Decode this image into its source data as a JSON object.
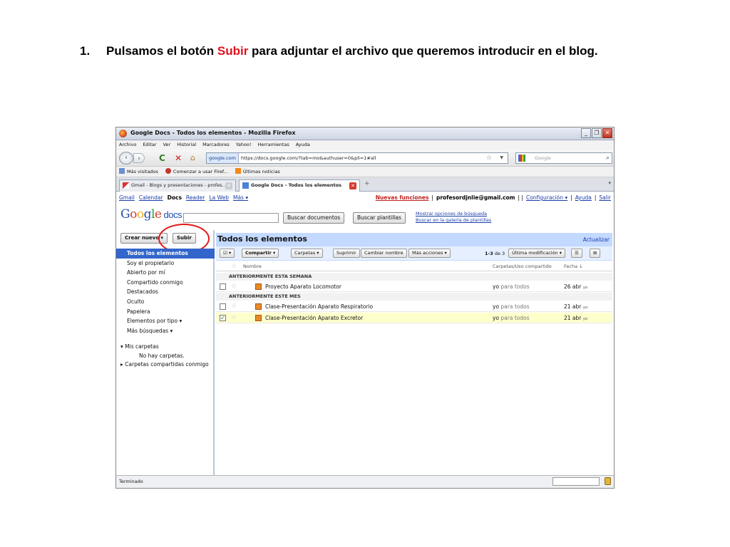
{
  "instruction": {
    "number": "1.",
    "before": "Pulsamos el botón ",
    "highlight": "Subir",
    "after": " para adjuntar el archivo que queremos introducir en el blog."
  },
  "window": {
    "title": "Google Docs - Todos los elementos - Mozilla Firefox",
    "minimize": "_",
    "restore": "❐",
    "close": "✕"
  },
  "menu": [
    "Archivo",
    "Editar",
    "Ver",
    "Historial",
    "Marcadores",
    "Yahoo!",
    "Herramientas",
    "Ayuda"
  ],
  "nav": {
    "back": "‹",
    "forward": "›",
    "reload": "C",
    "stop": "✕",
    "home": "⌂",
    "site": "google.com",
    "url": "https://docs.google.com/?tab=mo&authuser=0&pli=1#all",
    "star": "☆",
    "search_placeholder": "Google"
  },
  "bookmarks": [
    "Más visitados",
    "Comenzar a usar Firef...",
    "Últimas noticias"
  ],
  "tabs": [
    {
      "label": "Gmail - Blogs y presentaciones - profes...",
      "active": false
    },
    {
      "label": "Google Docs - Todos los elementos",
      "active": true
    }
  ],
  "gbar": {
    "links": [
      "Gmail",
      "Calendar",
      "Docs",
      "Reader",
      "La Web",
      "Más ▾"
    ],
    "new_features": "Nuevas funciones",
    "sep1": "|",
    "email": "profesordjnlie@gmail.com",
    "sep2": "| |",
    "settings": "Configuración ▾",
    "sep3": "|",
    "help": "Ayuda",
    "sep4": "|",
    "signout": "Salir"
  },
  "logo": {
    "g1": "G",
    "o1": "o",
    "o2": "o",
    "g2": "g",
    "l": "l",
    "e": "e",
    "docs": "docs"
  },
  "search": {
    "button_docs": "Buscar documentos",
    "button_templates": "Buscar plantillas",
    "options_link": "Mostrar opciones de búsqueda",
    "gallery_link": "Buscar en la galería de plantillas"
  },
  "sidebar": {
    "create_new": "Crear nuevo ▾",
    "upload": "Subir",
    "items": [
      "Todos los elementos",
      "Soy el propietario",
      "Abierto por mí",
      "Compartido conmigo",
      "Destacados",
      "Oculto",
      "Papelera",
      "Elementos por tipo ▾",
      "Más búsquedas ▾"
    ],
    "my_folders": "▾ Mis carpetas",
    "no_folders": "No hay carpetas.",
    "shared_folders": "▸ Carpetas compartidas conmigo"
  },
  "main": {
    "title": "Todos los elementos",
    "refresh": "Actualizar",
    "toolbar": {
      "select": "☑ ▾",
      "share": "Compartir ▾",
      "folders": "Carpetas ▾",
      "delete": "Suprimir",
      "rename": "Cambiar nombre",
      "more": "Más acciones ▾",
      "count_range": "1-3",
      "count_rest": " de 3",
      "sort": "Última modificación ▾",
      "view_list": "☰",
      "view_grid": "⊞"
    },
    "columns": {
      "name": "Nombre",
      "folders": "Carpetas/Uso compartido",
      "date": "Fecha ↓"
    },
    "groups": [
      "ANTERIORMENTE ESTA SEMANA",
      "ANTERIORMENTE ESTE MES"
    ],
    "rows": [
      {
        "name": "Proyecto Aparato Locomotor",
        "owner": "yo",
        "sharing": "para todos",
        "date": "26 abr",
        "by": "yo",
        "checked": false
      },
      {
        "name": "Clase-Presentación Aparato Respiratorio",
        "owner": "yo",
        "sharing": "para todos",
        "date": "21 abr",
        "by": "yo",
        "checked": false
      },
      {
        "name": "Clase-Presentación Aparato Excretor",
        "owner": "yo",
        "sharing": "para todos",
        "date": "21 abr",
        "by": "yo",
        "checked": true
      }
    ]
  },
  "status": {
    "text": "Terminado"
  },
  "colors": {
    "highlight": "#e0101a",
    "selection": "#3366cc",
    "header": "#c3d9ff",
    "ring": "#e01a1a"
  }
}
